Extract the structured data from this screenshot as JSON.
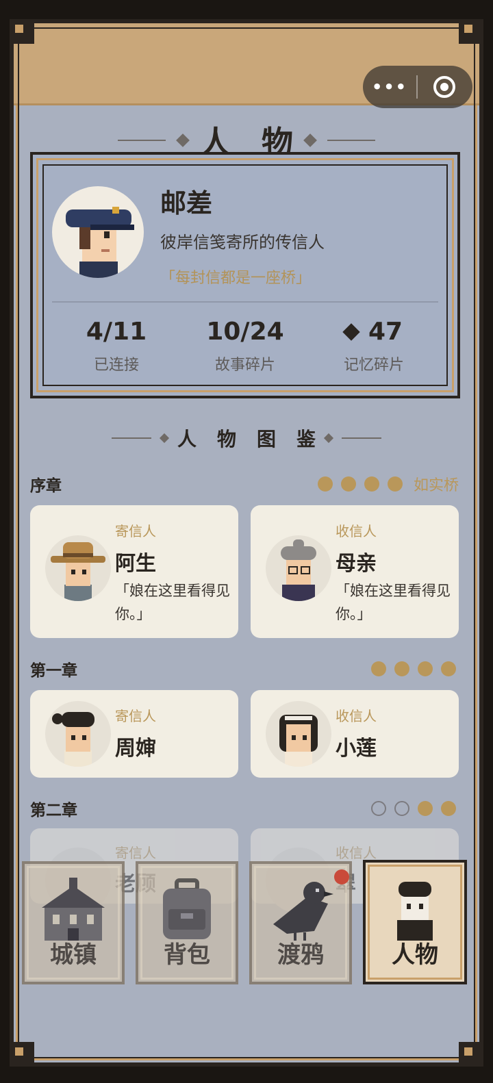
{
  "capsule": {
    "more_icon": "more-dots-icon",
    "close_icon": "target-icon"
  },
  "header": {
    "title": "人物"
  },
  "profile": {
    "name": "邮差",
    "description": "彼岸信笺寄所的传信人",
    "quote": "「每封信都是一座桥」",
    "stats": [
      {
        "value": "4/11",
        "label": "已连接"
      },
      {
        "value": "10/24",
        "label": "故事碎片"
      },
      {
        "value": "47",
        "label": "记忆碎片",
        "icon": "diamond-icon"
      }
    ]
  },
  "codex": {
    "title": "人物图鉴",
    "chapters": [
      {
        "name": "序章",
        "progress_filled": 4,
        "progress_total": 4,
        "label": "如实桥",
        "cards": [
          {
            "role": "寄信人",
            "name": "阿生",
            "quote": "「娘在这里看得见你。」"
          },
          {
            "role": "收信人",
            "name": "母亲",
            "quote": "「娘在这里看得见你。」"
          }
        ]
      },
      {
        "name": "第一章",
        "progress_filled": 4,
        "progress_total": 4,
        "cards": [
          {
            "role": "寄信人",
            "name": "周婶"
          },
          {
            "role": "收信人",
            "name": "小莲"
          }
        ]
      },
      {
        "name": "第二章",
        "progress_filled": 2,
        "progress_total": 4,
        "cards": [
          {
            "role": "寄信人",
            "name": "老顾"
          },
          {
            "role": "收信人",
            "name": "翠"
          }
        ]
      }
    ]
  },
  "tabbar": {
    "tabs": [
      {
        "label": "城镇",
        "icon": "town-icon"
      },
      {
        "label": "背包",
        "icon": "backpack-icon"
      },
      {
        "label": "渡鸦",
        "icon": "raven-icon"
      },
      {
        "label": "人物",
        "icon": "character-icon",
        "active": true
      }
    ]
  },
  "colors": {
    "accent_gold": "#b9975a",
    "frame_tan": "#c9a77a",
    "panel_blue": "#a9b0bf",
    "card_cream": "#f2eee3"
  }
}
